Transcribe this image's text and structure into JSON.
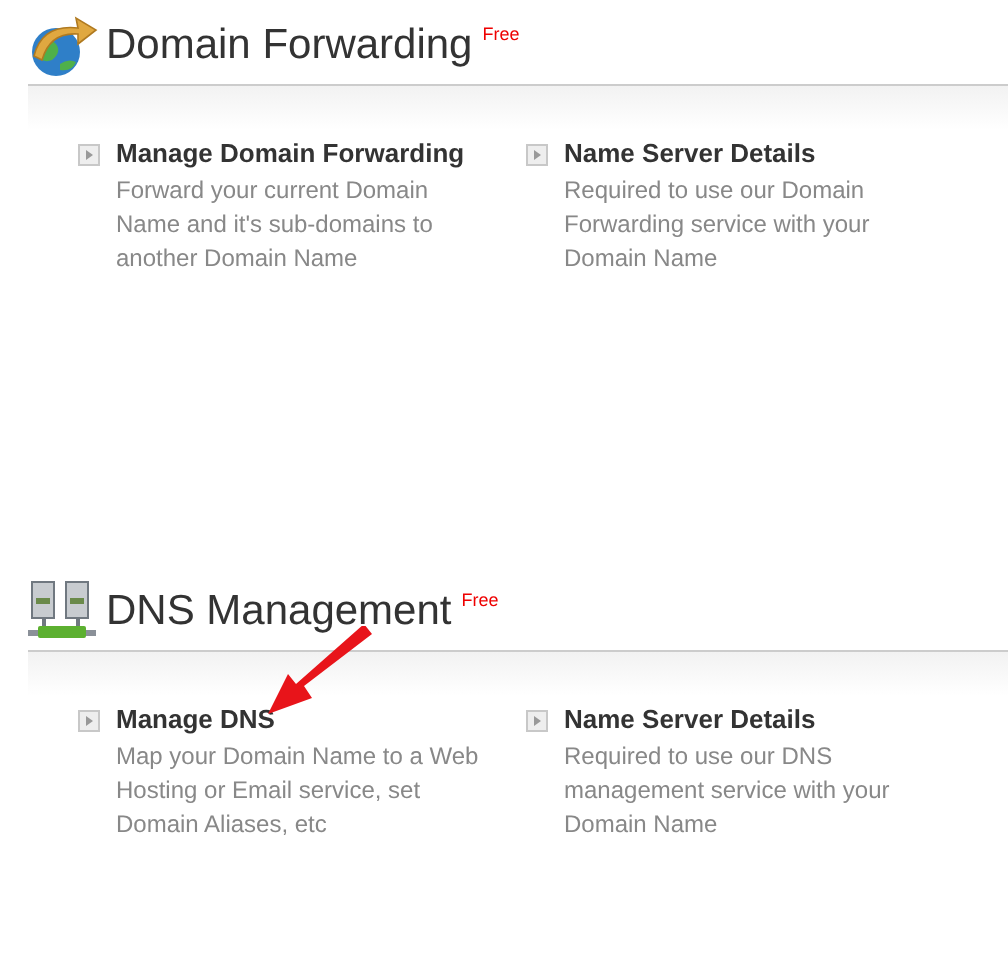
{
  "sections": [
    {
      "kind": "forwarding",
      "title": "Domain Forwarding",
      "badge": "Free",
      "links": [
        {
          "title": "Manage Domain Forwarding",
          "description": "Forward your current Domain Name and it's sub-domains to another Domain Name"
        },
        {
          "title": "Name Server Details",
          "description": "Required to use our Domain Forwarding service with your Domain Name"
        }
      ]
    },
    {
      "kind": "dns",
      "title": "DNS Management",
      "badge": "Free",
      "links": [
        {
          "title": "Manage DNS",
          "description": "Map your Domain Name to a Web Hosting or Email service, set Domain Aliases, etc"
        },
        {
          "title": "Name Server Details",
          "description": "Required to use our DNS management service with your Domain Name"
        }
      ]
    }
  ]
}
